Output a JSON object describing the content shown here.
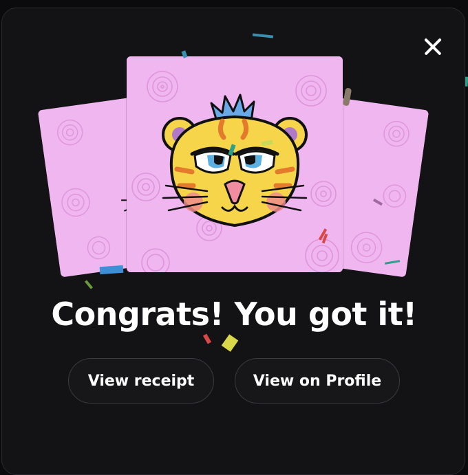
{
  "dialog": {
    "headline": "Congrats! You got it!",
    "close_icon": "close-icon"
  },
  "nft_cards": {
    "subject": "cartoon-tiger-face",
    "background_color": "#f0b6f0"
  },
  "actions": {
    "view_receipt_label": "View receipt",
    "view_profile_label": "View on Profile"
  },
  "colors": {
    "background": "#0b0b0d",
    "panel": "#131316",
    "button_border": "#3a3a3f",
    "text": "#ffffff"
  }
}
